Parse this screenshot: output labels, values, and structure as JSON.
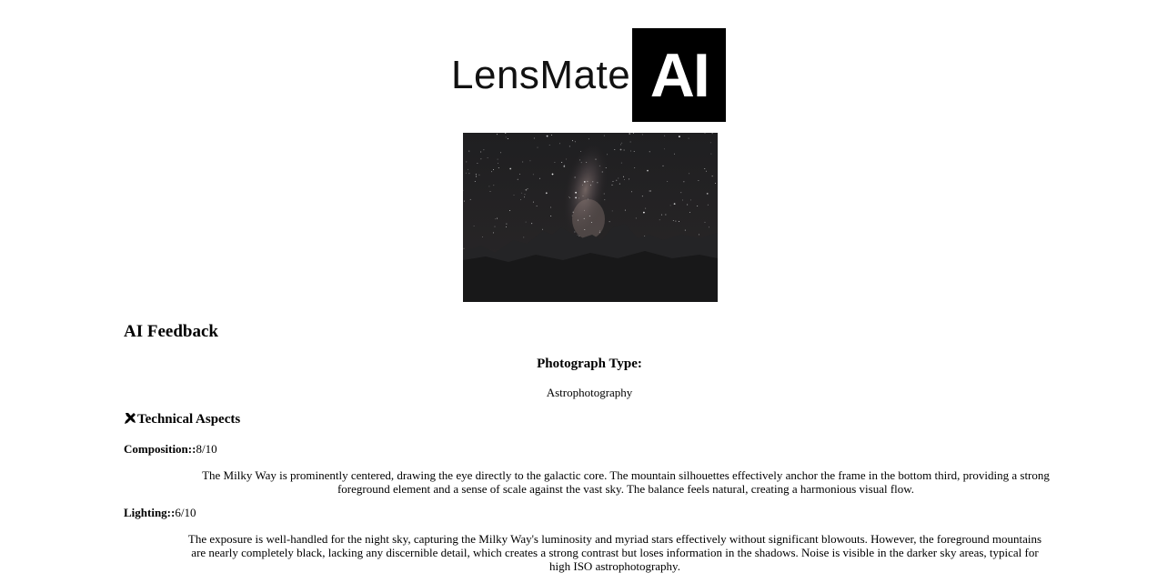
{
  "logo": {
    "word": "LensMate",
    "badge": "AI"
  },
  "feedback": {
    "heading": "AI Feedback",
    "photo_type_label": "Photograph Type:",
    "photo_type_value": "Astrophotography",
    "technical_heading": "Technical Aspects",
    "aspects": [
      {
        "label": "Composition::",
        "score": "8/10",
        "text": "The Milky Way is prominently centered, drawing the eye directly to the galactic core. The mountain silhouettes effectively anchor the frame in the bottom third, providing a strong foreground element and a sense of scale against the vast sky. The balance feels natural, creating a harmonious visual flow."
      },
      {
        "label": "Lighting::",
        "score": "6/10",
        "text": "The exposure is well-handled for the night sky, capturing the Milky Way's luminosity and myriad stars effectively without significant blowouts. However, the foreground mountains are nearly completely black, lacking any discernible detail, which creates a strong contrast but loses information in the shadows. Noise is visible in the darker sky areas, typical for high ISO astrophotography."
      }
    ]
  },
  "icons": {
    "technical": "tools-icon"
  },
  "colors": {
    "logo_badge_bg": "#000000",
    "text": "#000000"
  }
}
